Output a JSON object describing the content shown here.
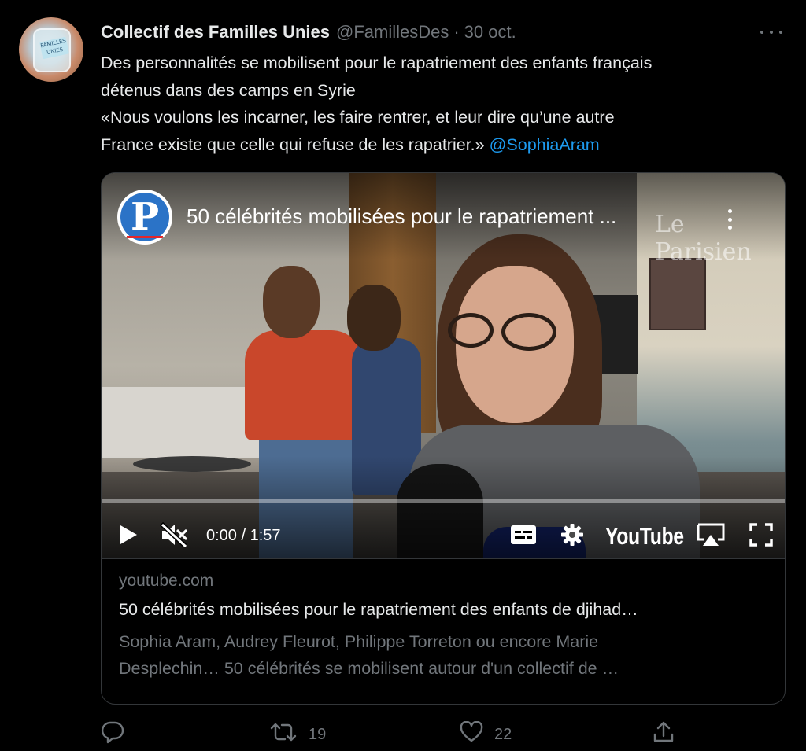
{
  "tweet": {
    "author_name": "Collectif des Familles Unies",
    "handle": "@FamillesDes",
    "separator": "·",
    "date": "30 oct.",
    "text_lines": [
      "Des personnalités se mobilisent pour le rapatriement des enfants français",
      "détenus dans des camps en Syrie",
      "«Nous voulons les incarner, les faire rentrer, et leur dire qu’une autre",
      "France existe que celle qui refuse de les rapatrier.» "
    ],
    "mention": "@SophiaAram",
    "avatar_label": "FAMILLES UNIES"
  },
  "video": {
    "channel_logo_letter": "P",
    "title": "50 célébrités mobilisées pour le rapatriement ...",
    "watermark": "Le Parisien",
    "time": "0:00 / 1:57",
    "progress": 0,
    "player_logo": "YouTube"
  },
  "card": {
    "domain": "youtube.com",
    "title": "50 célébrités mobilisées pour le rapatriement des enfants de djihad…",
    "description_lines": [
      "Sophia Aram, Audrey Fleurot, Philippe Torreton ou encore Marie",
      "Desplechin… 50 célébrités se mobilisent autour d'un collectif de …"
    ]
  },
  "actions": {
    "retweet_count": "19",
    "like_count": "22"
  },
  "icons": {
    "more": "more-icon",
    "play": "play-icon",
    "mute": "volume-muted-icon",
    "captions": "captions-icon",
    "settings": "gear-icon",
    "airplay": "airplay-icon",
    "fullscreen": "fullscreen-icon",
    "reply": "reply-icon",
    "retweet": "retweet-icon",
    "like": "heart-icon",
    "share": "share-icon"
  },
  "colors": {
    "background": "#000000",
    "text": "#e7e9ea",
    "muted": "#71767b",
    "link": "#1d9bf0",
    "border": "#333639"
  }
}
